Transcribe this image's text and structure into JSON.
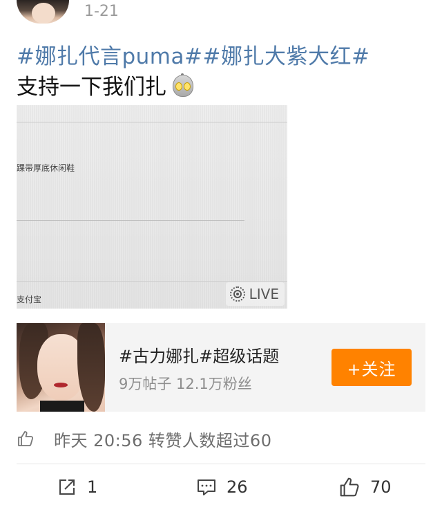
{
  "post": {
    "time": "1-21",
    "hashtags": "#娜扎代言puma##娜扎大紫大红#",
    "text": "支持一下我们扎",
    "emoji": "ultraman-emoji",
    "image": {
      "product_text": "踝带厚底休闲鞋",
      "payment_text": "支付宝",
      "live_label": "LIVE"
    }
  },
  "topic": {
    "title": "#古力娜扎#超级话题",
    "stats": "9万帖子 12.1万粉丝",
    "follow_label": "+关注"
  },
  "like_summary": {
    "text": "昨天 20:56 转赞人数超过60"
  },
  "actions": {
    "forward_count": "1",
    "comment_count": "26",
    "like_count": "70"
  },
  "colors": {
    "hashtag": "#4f7aa9",
    "follow_button": "#ff8200",
    "topic_card_bg": "#f4f4f4"
  }
}
